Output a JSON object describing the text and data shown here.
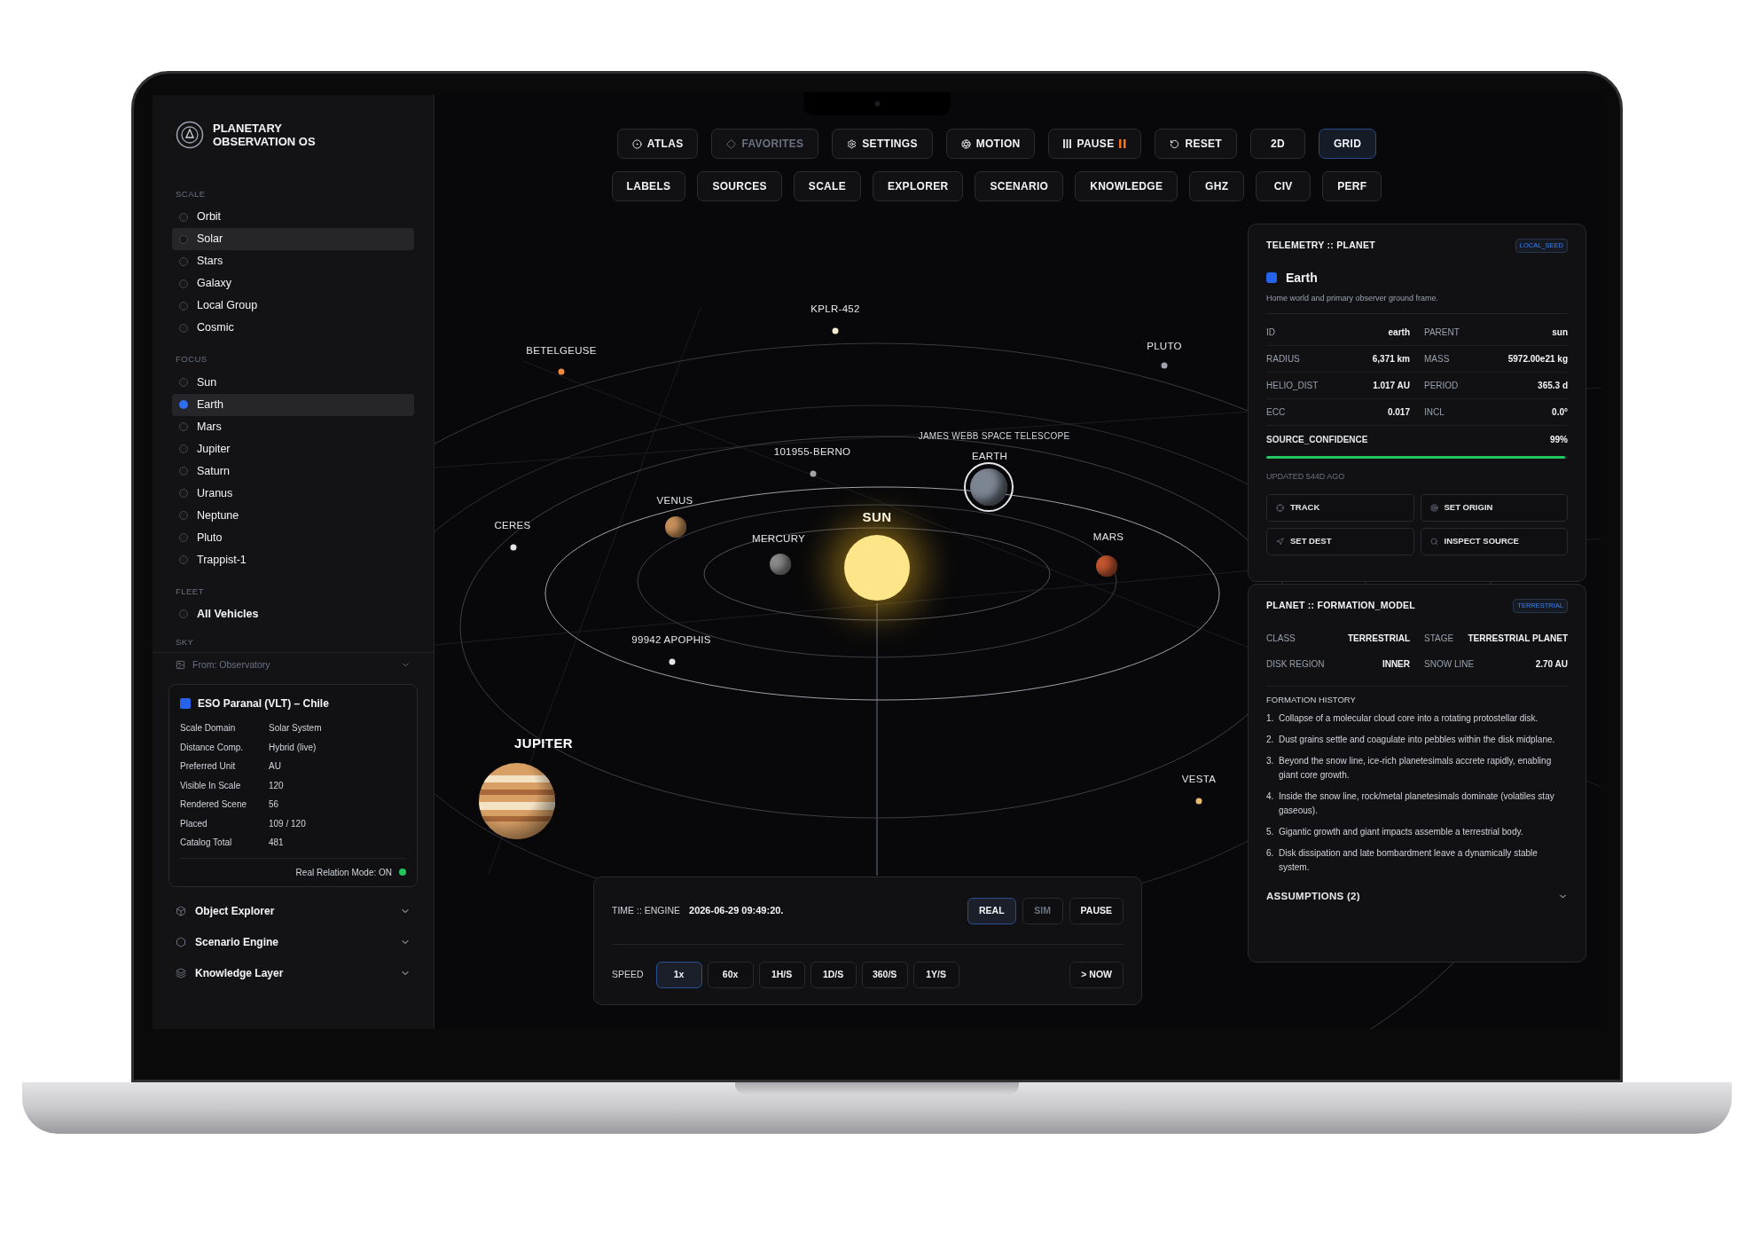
{
  "app": {
    "title": "PLANETARY OBSERVATION OS"
  },
  "sidebar": {
    "sections": [
      {
        "label": "SCALE",
        "kind": "plain",
        "items": [
          {
            "label": "Orbit",
            "selected": false
          },
          {
            "label": "Solar",
            "selected": true
          },
          {
            "label": "Stars",
            "selected": false
          },
          {
            "label": "Galaxy",
            "selected": false
          },
          {
            "label": "Local Group",
            "selected": false
          },
          {
            "label": "Cosmic",
            "selected": false
          }
        ]
      },
      {
        "label": "FOCUS",
        "kind": "focus",
        "items": [
          {
            "label": "Sun",
            "selected": false
          },
          {
            "label": "Earth",
            "selected": true
          },
          {
            "label": "Mars",
            "selected": false
          },
          {
            "label": "Jupiter",
            "selected": false
          },
          {
            "label": "Saturn",
            "selected": false
          },
          {
            "label": "Uranus",
            "selected": false
          },
          {
            "label": "Neptune",
            "selected": false
          },
          {
            "label": "Pluto",
            "selected": false
          },
          {
            "label": "Trappist-1",
            "selected": false
          }
        ]
      },
      {
        "label": "FLEET",
        "kind": "fleet",
        "items": [
          {
            "label": "All Vehicles",
            "selected": false
          }
        ]
      }
    ],
    "sky": {
      "label": "SKY",
      "value": "From: Observatory"
    },
    "observatory": {
      "title": "ESO Paranal (VLT) – Chile",
      "color": "#2563eb",
      "rows": [
        {
          "label": "Scale Domain",
          "value": "Solar System"
        },
        {
          "label": "Distance Comp.",
          "value": "Hybrid (live)"
        },
        {
          "label": "Preferred Unit",
          "value": "AU"
        },
        {
          "label": "Visible In Scale",
          "value": "120"
        },
        {
          "label": "Rendered Scene",
          "value": "56"
        },
        {
          "label": "Placed",
          "value": "109 / 120"
        },
        {
          "label": "Catalog Total",
          "value": "481"
        }
      ],
      "footer": "Real Relation Mode: ON",
      "status_on": true
    },
    "accordions": [
      {
        "label": "Object Explorer",
        "expanded": false
      },
      {
        "label": "Scenario Engine",
        "expanded": false
      },
      {
        "label": "Knowledge Layer",
        "expanded": false
      }
    ]
  },
  "toolbar": {
    "primary": [
      {
        "label": "ATLAS",
        "kind": "icon",
        "selected": false,
        "disabled": false
      },
      {
        "label": "FAVORITES",
        "kind": "icon",
        "selected": false,
        "disabled": true
      },
      {
        "label": "SETTINGS",
        "kind": "icon",
        "selected": false,
        "disabled": false
      },
      {
        "label": "MOTION",
        "kind": "icon",
        "selected": false,
        "disabled": false
      },
      {
        "label": "PAUSE",
        "kind": "pause",
        "selected": false,
        "disabled": false
      },
      {
        "label": "RESET",
        "kind": "icon",
        "selected": false,
        "disabled": false
      },
      {
        "label": "2D",
        "kind": "plain",
        "selected": false,
        "disabled": false
      },
      {
        "label": "GRID",
        "kind": "plain",
        "selected": true,
        "disabled": false
      }
    ],
    "secondary": [
      {
        "label": "LABELS",
        "selected": false,
        "disabled": false
      },
      {
        "label": "SOURCES",
        "selected": false,
        "disabled": false
      },
      {
        "label": "SCALE",
        "selected": false,
        "disabled": false
      },
      {
        "label": "EXPLORER",
        "selected": false,
        "disabled": false
      },
      {
        "label": "SCENARIO",
        "selected": false,
        "disabled": false
      },
      {
        "label": "KNOWLEDGE",
        "selected": false,
        "disabled": false
      },
      {
        "label": "GHZ",
        "selected": false,
        "disabled": false
      },
      {
        "label": "CIV",
        "selected": false,
        "disabled": false
      },
      {
        "label": "PERF",
        "selected": false,
        "disabled": false
      }
    ]
  },
  "bodies": [
    {
      "label": "KPLR-452",
      "kind": "point",
      "color": "#f5ecd0"
    },
    {
      "label": "BETELGEUSE",
      "kind": "point",
      "color": "#f08a3c"
    },
    {
      "label": "PLUTO",
      "kind": "point",
      "color": "#9ca3af"
    },
    {
      "label": "JAMES WEBB SPACE TELESCOPE",
      "kind": "label"
    },
    {
      "label": "EARTH",
      "kind": "ringed",
      "color": "#7c8592"
    },
    {
      "label": "101955-BERNO",
      "kind": "point",
      "color": "#a3a3a3"
    },
    {
      "label": "VENUS",
      "kind": "planet",
      "color": "#c8915a"
    },
    {
      "label": "CERES",
      "kind": "point",
      "color": "#e5e5e5"
    },
    {
      "label": "SUN",
      "kind": "sun",
      "color": "#fde68a"
    },
    {
      "label": "MERCURY",
      "kind": "planet",
      "color": "#8b8b8b"
    },
    {
      "label": "MARS",
      "kind": "planet",
      "color": "#c2562f"
    },
    {
      "label": "99942 APOPHIS",
      "kind": "point",
      "color": "#e5e5e5"
    },
    {
      "label": "JUPITER",
      "kind": "giant",
      "color": "#d9a066"
    },
    {
      "label": "VESTA",
      "kind": "point",
      "color": "#e9b96e"
    }
  ],
  "telemetry": {
    "title": "TELEMETRY :: PLANET",
    "badge": "LOCAL_SEED",
    "name": "Earth",
    "color": "#2563eb",
    "description": "Home world and primary observer ground frame.",
    "stats": [
      [
        {
          "label": "ID",
          "value": "earth"
        },
        {
          "label": "PARENT",
          "value": "sun"
        }
      ],
      [
        {
          "label": "RADIUS",
          "value": "6,371 km"
        },
        {
          "label": "MASS",
          "value": "5972.00e21 kg"
        }
      ],
      [
        {
          "label": "HELIO_DIST",
          "value": "1.017 AU"
        },
        {
          "label": "PERIOD",
          "value": "365.3 d"
        }
      ],
      [
        {
          "label": "ECC",
          "value": "0.017"
        },
        {
          "label": "INCL",
          "value": "0.0°"
        }
      ]
    ],
    "confidence": {
      "label": "SOURCE_CONFIDENCE",
      "value": "99%",
      "level": 0.99
    },
    "updated": "UPDATED 544D AGO",
    "actions": [
      "TRACK",
      "SET ORIGIN",
      "SET DEST",
      "INSPECT SOURCE"
    ]
  },
  "formation": {
    "title": "PLANET :: FORMATION_MODEL",
    "badge": "TERRESTRIAL",
    "stats": [
      [
        {
          "label": "CLASS",
          "value": "TERRESTRIAL"
        },
        {
          "label": "STAGE",
          "value": "TERRESTRIAL PLANET"
        }
      ],
      [
        {
          "label": "DISK REGION",
          "value": "INNER"
        },
        {
          "label": "SNOW LINE",
          "value": "2.70 AU"
        }
      ]
    ],
    "history_title": "FORMATION HISTORY",
    "history": [
      {
        "n": "1.",
        "text": "Collapse of a molecular cloud core into a rotating protostellar disk."
      },
      {
        "n": "2.",
        "text": "Dust grains settle and coagulate into pebbles within the disk midplane."
      },
      {
        "n": "3.",
        "text": "Beyond the snow line, ice-rich planetesimals accrete rapidly, enabling giant core growth."
      },
      {
        "n": "4.",
        "text": "Inside the snow line, rock/metal planetesimals dominate (volatiles stay gaseous)."
      },
      {
        "n": "5.",
        "text": "Gigantic growth and giant impacts assemble a terrestrial body."
      },
      {
        "n": "6.",
        "text": "Disk dissipation and late bombardment leave a dynamically stable system."
      }
    ],
    "assumptions": {
      "label": "ASSUMPTIONS (2)",
      "expanded": false
    }
  },
  "time_engine": {
    "label": "TIME :: ENGINE",
    "value": "2026-06-29 09:49:20.",
    "modes": [
      {
        "label": "REAL",
        "selected": true,
        "disabled": false
      },
      {
        "label": "SIM",
        "selected": false,
        "disabled": true
      },
      {
        "label": "PAUSE",
        "selected": false,
        "disabled": false
      }
    ],
    "speed_label": "SPEED",
    "speeds": [
      {
        "label": "1x",
        "selected": true
      },
      {
        "label": "60x",
        "selected": false
      },
      {
        "label": "1H/S",
        "selected": false
      },
      {
        "label": "1D/S",
        "selected": false
      },
      {
        "label": "360/S",
        "selected": false
      },
      {
        "label": "1Y/S",
        "selected": false
      }
    ],
    "now": "> NOW"
  }
}
